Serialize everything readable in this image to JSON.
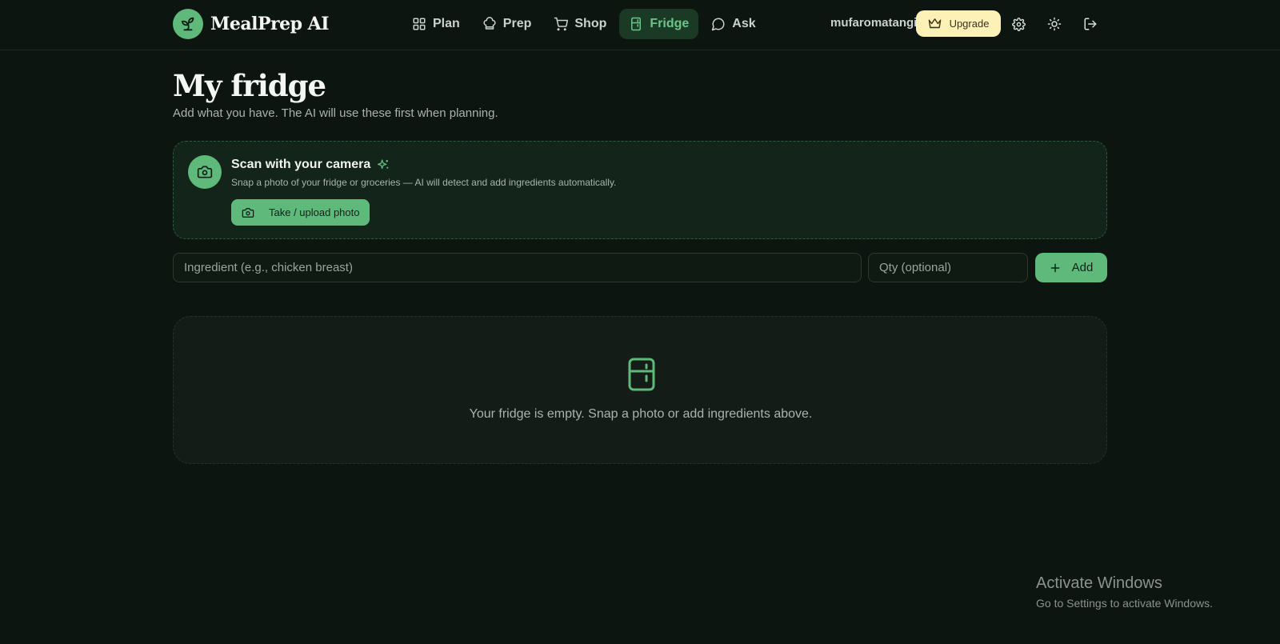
{
  "brand": {
    "name": "MealPrep AI",
    "logo_icon": "sprout-icon"
  },
  "nav": [
    {
      "label": "Plan",
      "icon": "grid-icon",
      "active": false
    },
    {
      "label": "Prep",
      "icon": "chef-hat-icon",
      "active": false
    },
    {
      "label": "Shop",
      "icon": "cart-icon",
      "active": false
    },
    {
      "label": "Fridge",
      "icon": "fridge-icon",
      "active": true
    },
    {
      "label": "Ask",
      "icon": "chat-icon",
      "active": false
    }
  ],
  "header": {
    "username": "mufaromatangi",
    "upgrade_label": "Upgrade"
  },
  "page": {
    "title": "My fridge",
    "subtitle": "Add what you have. The AI will use these first when planning."
  },
  "scan": {
    "title": "Scan with your camera",
    "description": "Snap a photo of your fridge or groceries — AI will detect and add ingredients automatically.",
    "button_label": "Take / upload photo"
  },
  "add_form": {
    "ingredient_placeholder": "Ingredient (e.g., chicken breast)",
    "qty_placeholder": "Qty (optional)",
    "add_label": "Add"
  },
  "empty_state": {
    "message": "Your fridge is empty. Snap a photo or add ingredients above."
  },
  "watermark": {
    "title": "Activate Windows",
    "subtitle": "Go to Settings to activate Windows."
  },
  "colors": {
    "background": "#0d1510",
    "accent": "#5fb97a",
    "upgrade": "#fdf1b8"
  }
}
